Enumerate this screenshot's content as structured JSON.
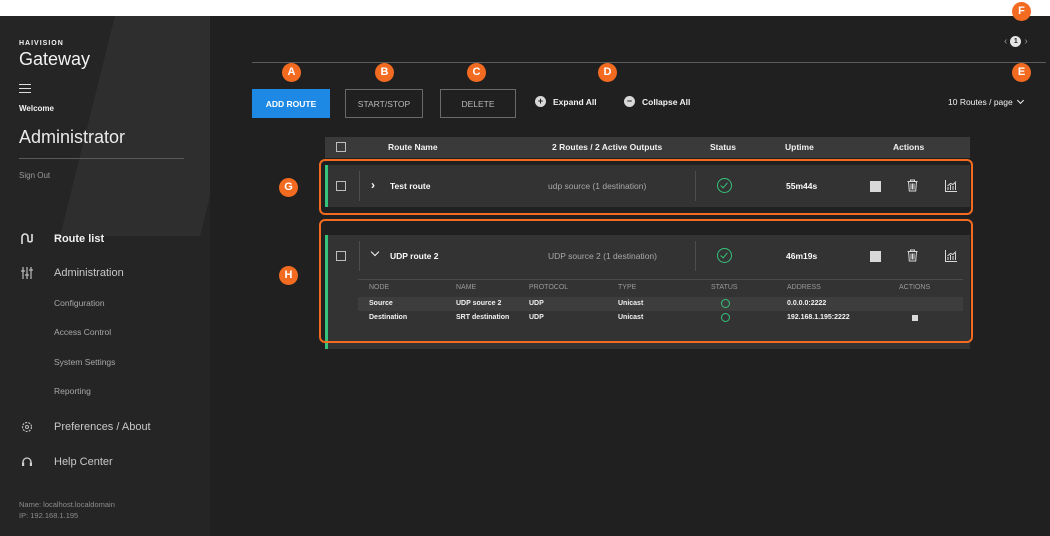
{
  "brand": {
    "small": "HAIVISION",
    "big": "Gateway"
  },
  "sidebar": {
    "welcome": "Welcome",
    "user": "Administrator",
    "sign_out": "Sign Out",
    "nav": {
      "route_list": "Route list",
      "administration": "Administration",
      "preferences": "Preferences / About",
      "help": "Help Center"
    },
    "subnav": [
      "Configuration",
      "Access Control",
      "System Settings",
      "Reporting"
    ],
    "host_name": "Name: localhost.localdomain",
    "host_ip": "IP: 192.168.1.195"
  },
  "pager": {
    "prev": "‹",
    "current": "1",
    "next": "›"
  },
  "toolbar": {
    "add_route": "ADD ROUTE",
    "start_stop": "START/STOP",
    "delete": "DELETE",
    "expand_all": "Expand All",
    "collapse_all": "Collapse All",
    "per_page": "10 Routes / page"
  },
  "table": {
    "headers": {
      "route_name": "Route Name",
      "summary": "2 Routes / 2 Active Outputs",
      "status": "Status",
      "uptime": "Uptime",
      "actions": "Actions"
    },
    "routes": [
      {
        "name": "Test route",
        "source": "udp source (1 destination)",
        "uptime": "55m44s",
        "expanded": false
      },
      {
        "name": "UDP route 2",
        "source": "UDP source 2 (1 destination)",
        "uptime": "46m19s",
        "expanded": true
      }
    ],
    "detail_headers": [
      "NODE",
      "NAME",
      "PROTOCOL",
      "TYPE",
      "STATUS",
      "ADDRESS",
      "ACTIONS"
    ],
    "detail_rows": [
      {
        "node": "Source",
        "name": "UDP source 2",
        "protocol": "UDP",
        "type": "Unicast",
        "address": "0.0.0.0:2222"
      },
      {
        "node": "Destination",
        "name": "SRT destination",
        "protocol": "UDP",
        "type": "Unicast",
        "address": "192.168.1.195:2222"
      }
    ]
  },
  "callouts": {
    "a": "A",
    "b": "B",
    "c": "C",
    "d": "D",
    "e": "E",
    "f": "F",
    "g": "G",
    "h": "H"
  },
  "colors": {
    "accent": "#1e88e5",
    "status_ok": "#35c27a",
    "callout": "#f26b21",
    "background": "#202020",
    "sidebar": "#252525"
  },
  "icons": {
    "route_list": "route-icon",
    "administration": "sliders-icon",
    "preferences": "gear-icon",
    "help": "headset-icon",
    "status": "check-circle-icon",
    "stop": "stop-icon",
    "delete": "trash-icon",
    "stats": "chart-icon"
  }
}
